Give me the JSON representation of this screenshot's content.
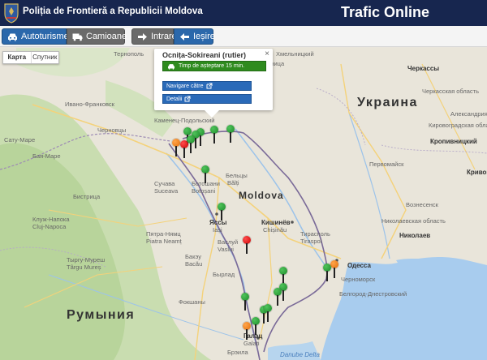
{
  "header": {
    "org_name": "Poliția de Frontieră a Republicii Moldova",
    "app_title": "Trafic Online"
  },
  "toolbar": {
    "cars_label": "Autoturisme",
    "trucks_label": "Camioane",
    "entry_label": "Intrare",
    "exit_label": "Ieșire"
  },
  "map": {
    "map_type_options": [
      "Карта",
      "Спутник"
    ],
    "labels": {
      "ukraine": "Украина",
      "moldova": "Moldova",
      "romania": "Румыния",
      "cherkasy": "Черкассы",
      "cherkasy_obl": "Черкасская область",
      "kropyvnytskyi": "Кропивницкий",
      "kirovohrad_obl": "Кировоградская область",
      "oleksandriia": "Александрия",
      "kryvyi_rih": "Кривой",
      "pervomaisk": "Первомайск",
      "voznesensk": "Вознесенск",
      "mykolaiv_obl": "Николаевская область",
      "mykolaiv": "Николаев",
      "odesa": "Одесса",
      "chornomorsk": "Черноморск",
      "bilhorod": "Белгород-Днестровский",
      "vinnytsia": "Винница",
      "kam_pod": "Каменец-Подольский",
      "ivano_frankivsk": "Ивано-Франковск",
      "chernivtsi": "Черновцы",
      "suceava": "Сучава",
      "suceava_ro": "Suceava",
      "botosani": "Ботошани",
      "botosani_ro": "Botoșani",
      "beltsy": "Бельцы",
      "balti": "Bălți",
      "iasi": "Яссы",
      "iasi_ro": "Iași",
      "chisinau": "Кишинёв",
      "chisinau_ro": "Chișinău",
      "tiraspol": "Тирасполь",
      "tiraspol_ro": "Tiraspol",
      "bacau": "Бакэу",
      "bacau_ro": "Bacău",
      "piatra_neamt": "Пятра-Нямц",
      "piatra_neamt_ro": "Piatra Neamț",
      "cluj": "Клуж-Напока",
      "cluj_ro": "Cluj-Napoca",
      "bistrita": "Бистрица",
      "targu_mures": "Тыргу-Муреш",
      "targu_mures_ro": "Târgu Mureș",
      "galati": "Галац",
      "galati_ro": "Galați",
      "braila": "Брэила",
      "danube_delta": "Danube Delta",
      "lviv_near": "Тернополь",
      "khmelnytskyi": "Хмельницкий",
      "baia_mare": "Бая-Маре",
      "vaslui": "Васлуй",
      "vaslui_ro": "Vaslui",
      "focsani": "Фокшаны",
      "barlad": "Бырлад",
      "satu_mare": "Сату-Маре"
    }
  },
  "popup": {
    "title": "Ocnița-Sokireani (rutier)",
    "wait_text": "Timp de așteptare 15 min.",
    "nav_label": "Navigare către",
    "details_label": "Detalii",
    "close_glyph": "×"
  },
  "colors": {
    "status_ok": "#2e8b1e",
    "status_busy": "#e36e0a",
    "status_congested": "#cc0000",
    "header_bg": "#17264f",
    "button_blue": "#2b68ab"
  },
  "markers": [
    {
      "name": "crossing-ocnita-sokireani",
      "status": "green"
    },
    {
      "name": "crossing-north-1",
      "status": "green"
    },
    {
      "name": "crossing-north-2",
      "status": "green"
    },
    {
      "name": "crossing-north-3",
      "status": "green"
    },
    {
      "name": "crossing-north-4",
      "status": "green"
    },
    {
      "name": "crossing-criva-mamaliga",
      "status": "orange"
    },
    {
      "name": "crossing-larga",
      "status": "red"
    },
    {
      "name": "crossing-lipcani",
      "status": "green"
    },
    {
      "name": "crossing-costesti",
      "status": "green"
    },
    {
      "name": "crossing-sculeni",
      "status": "green"
    },
    {
      "name": "crossing-leuseni",
      "status": "red"
    },
    {
      "name": "crossing-palanca",
      "status": "orange"
    },
    {
      "name": "crossing-tudora",
      "status": "green"
    },
    {
      "name": "crossing-east-1",
      "status": "green"
    },
    {
      "name": "crossing-east-2",
      "status": "green"
    },
    {
      "name": "crossing-east-3",
      "status": "green"
    },
    {
      "name": "crossing-south-1",
      "status": "green"
    },
    {
      "name": "crossing-south-2",
      "status": "green"
    },
    {
      "name": "crossing-south-3",
      "status": "green"
    },
    {
      "name": "crossing-giurgiulesti",
      "status": "orange"
    },
    {
      "name": "crossing-cahul",
      "status": "green"
    }
  ]
}
